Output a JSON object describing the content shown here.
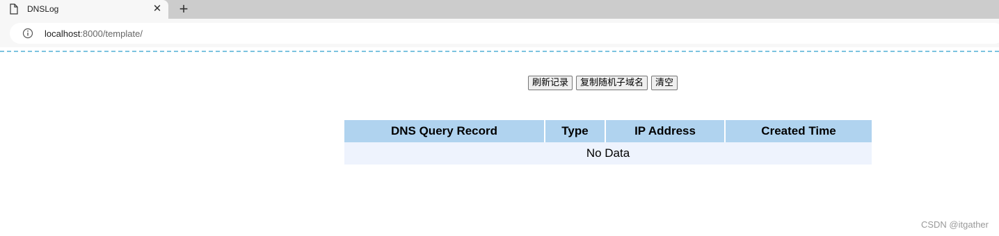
{
  "browser": {
    "tab_title": "DNSLog",
    "close_glyph": "✕",
    "new_tab_glyph": "+",
    "url_host": "localhost",
    "url_rest": ":8000/template/"
  },
  "buttons": {
    "refresh": "刷新记录",
    "copy_subdomain": "复制随机子域名",
    "clear": "清空"
  },
  "table": {
    "headers": [
      "DNS Query Record",
      "Type",
      "IP Address",
      "Created Time"
    ],
    "empty_text": "No Data"
  },
  "watermark": "CSDN @itgather",
  "colors": {
    "header_bg": "#b0d3ef",
    "row_bg": "#eef3fd",
    "dashed_line": "#7cc3df"
  },
  "icons": {
    "tab": "page-icon",
    "address": "info-icon"
  }
}
